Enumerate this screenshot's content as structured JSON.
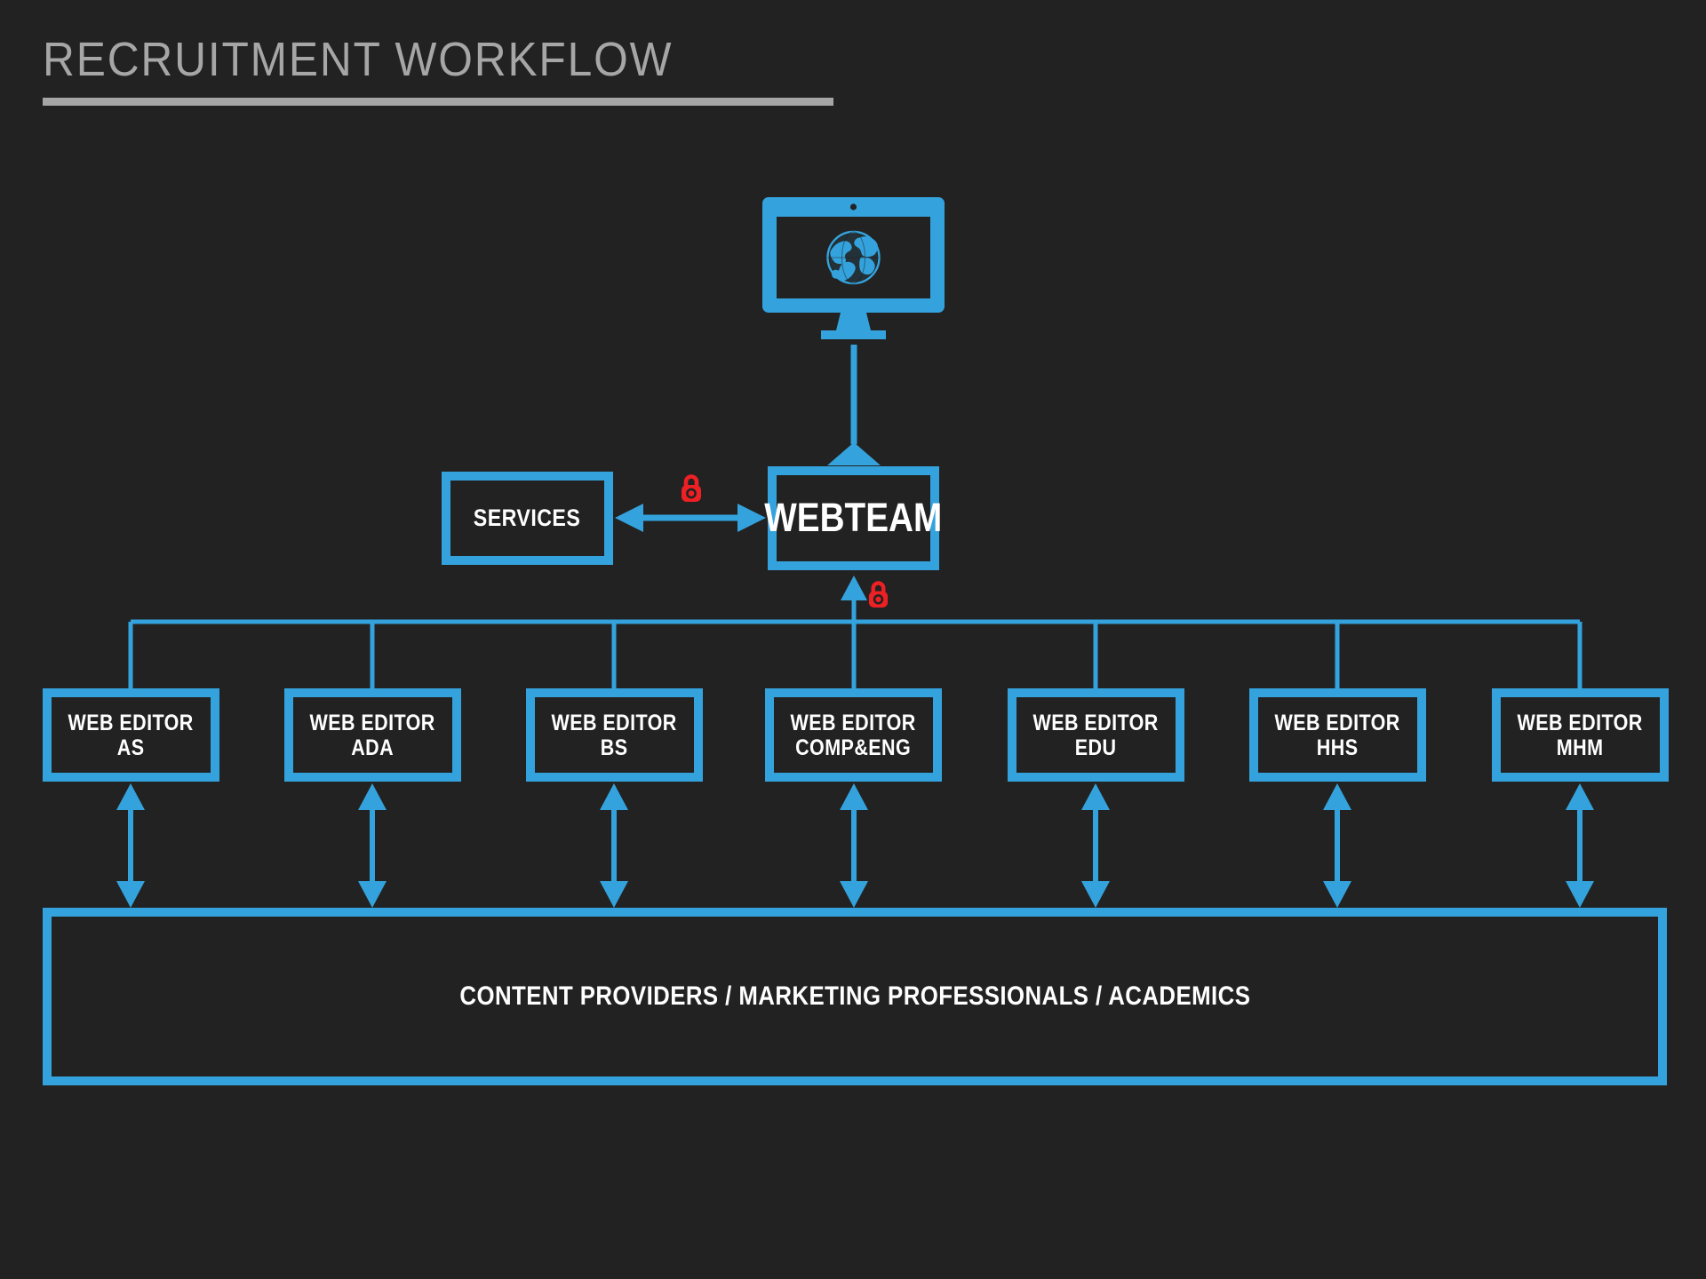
{
  "page": {
    "title": "RECRUITMENT WORKFLOW",
    "background_color": "#222222",
    "accent_color": "#34a3dd",
    "title_color": "#a6a6a6",
    "lock_color": "#ed2024",
    "text_color": "#ffffff"
  },
  "diagram": {
    "type": "organizational-flow",
    "top_icon": {
      "name": "web-monitor-icon",
      "description": "desktop monitor displaying a globe"
    },
    "nodes": {
      "services": {
        "label": "SERVICES"
      },
      "webteam": {
        "label": "WEBTEAM"
      },
      "providers": {
        "label": "CONTENT PROVIDERS / MARKETING PROFESSIONALS / ACADEMICS"
      }
    },
    "editors": [
      {
        "line1": "WEB EDITOR",
        "line2": "AS"
      },
      {
        "line1": "WEB EDITOR",
        "line2": "ADA"
      },
      {
        "line1": "WEB EDITOR",
        "line2": "BS"
      },
      {
        "line1": "WEB EDITOR",
        "line2": "COMP&ENG"
      },
      {
        "line1": "WEB EDITOR",
        "line2": "EDU"
      },
      {
        "line1": "WEB EDITOR",
        "line2": "HHS"
      },
      {
        "line1": "WEB EDITOR",
        "line2": "MHM"
      }
    ],
    "locks": [
      {
        "name": "lock-services-webteam"
      },
      {
        "name": "lock-editors-webteam"
      }
    ],
    "connections": [
      {
        "from": "webteam",
        "to": "monitor",
        "style": "arrow-up"
      },
      {
        "from": "services",
        "to": "webteam",
        "style": "double-arrow-horizontal",
        "secured": true
      },
      {
        "from": "editors-bus",
        "to": "webteam",
        "style": "arrow-up",
        "secured": true
      },
      {
        "from": "editors",
        "to": "providers",
        "style": "double-arrow-vertical"
      }
    ]
  }
}
